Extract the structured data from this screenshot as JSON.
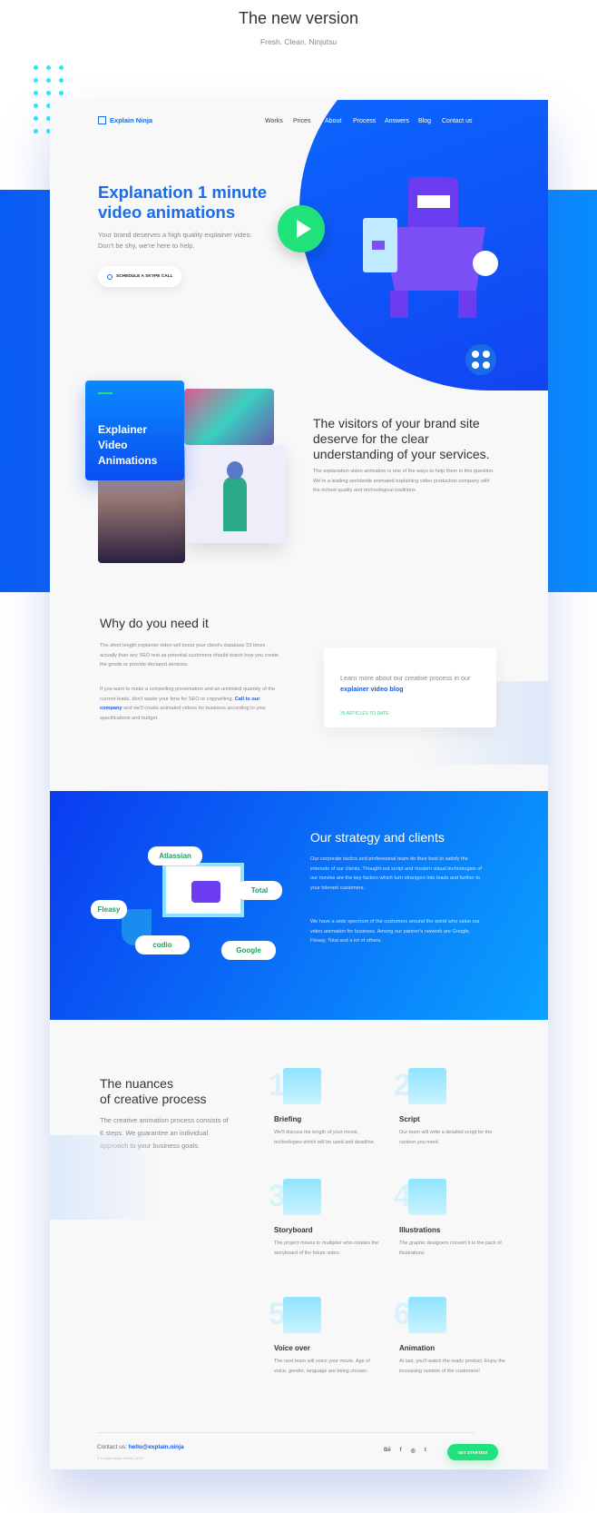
{
  "showcase": {
    "title": "The new version",
    "subtitle": "Fresh. Clean. Ninjutsu"
  },
  "colors": {
    "brand_blue": "#1a6ce6",
    "accent_green": "#20e27a",
    "gradient_start": "#0a3cf0",
    "gradient_end": "#0aa2ff"
  },
  "nav": {
    "logo": "Explain Ninja",
    "logo_icon": "scroll-icon",
    "items": [
      "Works",
      "Prices",
      "About",
      "Process",
      "Answers",
      "Blog",
      "Contact us"
    ]
  },
  "hero": {
    "headline": "Explanation 1 minute video animations",
    "text": "Your brand deserves a high quality explainer video. Don't be shy, we're here to help.",
    "cta": "SCHEDULE A SKYPE CALL",
    "cta_icon": "clock-icon",
    "play_icon": "play-icon"
  },
  "visitors": {
    "card_title": "Explainer Video Animations",
    "heading": "The visitors of your brand site deserve for the clear understanding of your services.",
    "text": "The explanation video animation is one of the ways to help them in this question. We're a leading worldwide animated explaining video production company with the richest quality and technological traditions."
  },
  "why": {
    "heading": "Why do you need it",
    "p1": "The short length explainer video will boost your client's database 53 times actually than any SEO text as potential customers should watch how you create the goods or provide declared services.",
    "p2_a": "If you want to make a compelling presentation and an unlimited quantity of the current leads, don't waste your time for SEO or copywriting. ",
    "p2_link": "Call to our company",
    "p2_b": " and we'll create animated videos for business according to your specifications and budget.",
    "blog_text": "Learn more about our creative process in our ",
    "blog_link": "explainer video blog",
    "blog_count": "35 ARTICLES TO DATE"
  },
  "strategy": {
    "heading": "Our strategy and clients",
    "p1": "Our corporate tactics and professional team do their best to satisfy the interests of our clients. Thought-out script and modern visual technologies of our movies are the key factors which turn strangers into leads and further to your tolerant customers.",
    "p2": "We have a wide spectrum of the customers around the world who value our video animation for business. Among our partner's network are Google, Fleasy, Total and a lot of others.",
    "clients": [
      "Atlassian",
      "Total",
      "Fleasy",
      "codio",
      "Google"
    ]
  },
  "process": {
    "heading_1": "The nuances",
    "heading_2": "of creative process",
    "text": "The creative animation process consists of 6 steps. We guarantee an individual approach to your business goals.",
    "steps": [
      {
        "num": "1",
        "title": "Briefing",
        "text": "We'll discuss the length of your movie, technologies which will be used and deadline.",
        "icon": "notepad-pen-icon"
      },
      {
        "num": "2",
        "title": "Script",
        "text": "Our team will write a detailed script for the cartoon you need.",
        "icon": "document-clip-icon"
      },
      {
        "num": "3",
        "title": "Storyboard",
        "text": "The project moves to multiplier who creates the storyboard of the future video.",
        "icon": "storyboard-grid-icon"
      },
      {
        "num": "4",
        "title": "Illustrations",
        "text": "The graphic designers convert it to the pack of illustrations.",
        "icon": "house-icon"
      },
      {
        "num": "5",
        "title": "Voice over",
        "text": "The next team will voice your movie. Age of voice, gender, language are being chosen.",
        "icon": "megaphone-icon"
      },
      {
        "num": "6",
        "title": "Animation",
        "text": "At last, you'll watch the ready product. Enjoy the increasing number of the customers!",
        "icon": "flag-icon"
      }
    ]
  },
  "footer": {
    "contact_label": "Contact us: ",
    "email": "hello@explain.ninja",
    "copyright": "© Explain Ninja Studio, 2016",
    "social": [
      "Bē",
      "f",
      "◎",
      "t"
    ],
    "social_icons": [
      "behance-icon",
      "facebook-icon",
      "instagram-icon",
      "twitter-icon"
    ],
    "cta": "GET STARTED!"
  }
}
